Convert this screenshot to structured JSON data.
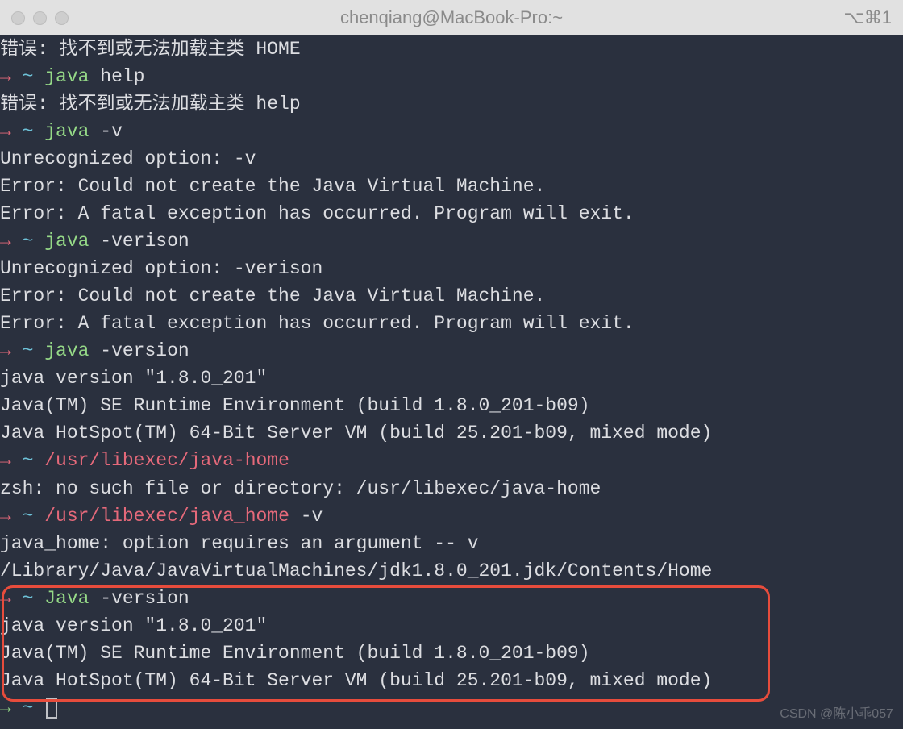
{
  "window": {
    "title": "chenqiang@MacBook-Pro:~",
    "right_indicator": "⌥⌘1"
  },
  "prompt": {
    "arrow": "→",
    "tilde": "~"
  },
  "lines": [
    {
      "type": "out",
      "text": "错误: 找不到或无法加载主类 HOME"
    },
    {
      "type": "prompt",
      "cmd": "java",
      "cmd_style": "green",
      "args": "help"
    },
    {
      "type": "out",
      "text": "错误: 找不到或无法加载主类 help"
    },
    {
      "type": "prompt",
      "cmd": "java",
      "cmd_style": "green",
      "args": "-v"
    },
    {
      "type": "out",
      "text": "Unrecognized option: -v"
    },
    {
      "type": "out",
      "text": "Error: Could not create the Java Virtual Machine."
    },
    {
      "type": "out",
      "text": "Error: A fatal exception has occurred. Program will exit."
    },
    {
      "type": "prompt",
      "cmd": "java",
      "cmd_style": "green",
      "args": "-verison"
    },
    {
      "type": "out",
      "text": "Unrecognized option: -verison"
    },
    {
      "type": "out",
      "text": "Error: Could not create the Java Virtual Machine."
    },
    {
      "type": "out",
      "text": "Error: A fatal exception has occurred. Program will exit."
    },
    {
      "type": "prompt",
      "cmd": "java",
      "cmd_style": "green",
      "args": "-version"
    },
    {
      "type": "out",
      "text": "java version \"1.8.0_201\""
    },
    {
      "type": "out",
      "text": "Java(TM) SE Runtime Environment (build 1.8.0_201-b09)"
    },
    {
      "type": "out",
      "text": "Java HotSpot(TM) 64-Bit Server VM (build 25.201-b09, mixed mode)"
    },
    {
      "type": "prompt",
      "cmd": "/usr/libexec/java-home",
      "cmd_style": "red",
      "args": ""
    },
    {
      "type": "out",
      "text": "zsh: no such file or directory: /usr/libexec/java-home"
    },
    {
      "type": "prompt",
      "cmd": "/usr/libexec/java_home",
      "cmd_style": "red",
      "args": "-v"
    },
    {
      "type": "out",
      "text": "java_home: option requires an argument -- v"
    },
    {
      "type": "out",
      "text": "/Library/Java/JavaVirtualMachines/jdk1.8.0_201.jdk/Contents/Home"
    },
    {
      "type": "prompt",
      "cmd": "Java",
      "cmd_style": "green",
      "args": "-version"
    },
    {
      "type": "out",
      "text": "java version \"1.8.0_201\""
    },
    {
      "type": "out",
      "text": "Java(TM) SE Runtime Environment (build 1.8.0_201-b09)"
    },
    {
      "type": "out",
      "text": "Java HotSpot(TM) 64-Bit Server VM (build 25.201-b09, mixed mode)"
    },
    {
      "type": "prompt-cursor"
    }
  ],
  "watermark": "CSDN @陈小乖057"
}
